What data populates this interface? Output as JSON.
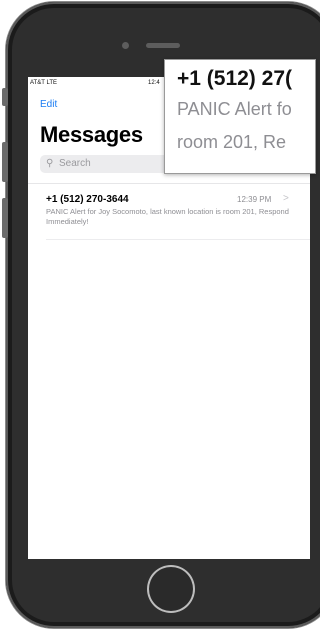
{
  "status_bar": {
    "carrier": "AT&T  LTE",
    "time": "12:4"
  },
  "nav": {
    "edit_label": "Edit",
    "title": "Messages"
  },
  "search": {
    "icon": "magnifier-icon",
    "glyph": "⚲",
    "placeholder": "Search"
  },
  "messages": [
    {
      "sender": "+1 (512) 270-3644",
      "time": "12:39 PM",
      "chevron": ">",
      "preview": "PANIC Alert for Joy Socomoto, last known location is room 201, Respond Immediately!"
    }
  ],
  "zoom_callout": {
    "sender": "+1 (512) 27(",
    "line1": "PANIC Alert fo",
    "line2": "room 201, Re"
  }
}
